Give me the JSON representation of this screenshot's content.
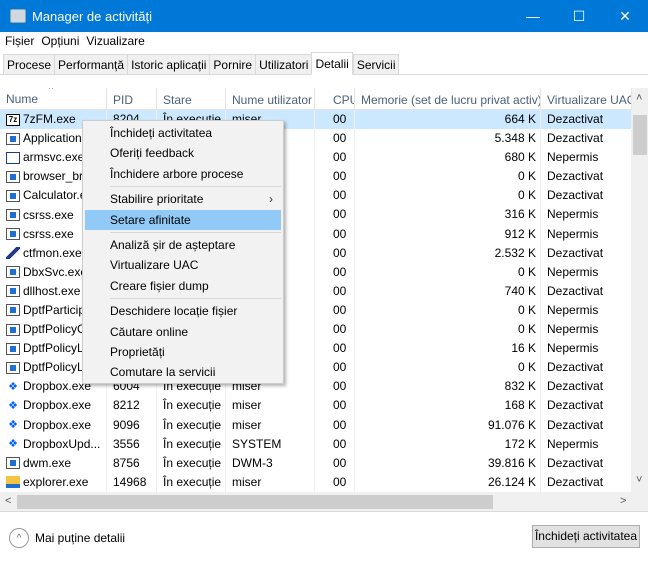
{
  "window": {
    "title": "Manager de activități",
    "minimize": "—",
    "maximize": "☐",
    "close": "✕"
  },
  "menu": [
    "Fișier",
    "Opțiuni",
    "Vizualizare"
  ],
  "tabs": [
    {
      "label": "Procese"
    },
    {
      "label": "Performanță"
    },
    {
      "label": "Istoric aplicații"
    },
    {
      "label": "Pornire"
    },
    {
      "label": "Utilizatori"
    },
    {
      "label": "Detalii",
      "active": true
    },
    {
      "label": "Servicii"
    }
  ],
  "columns": [
    "Nume",
    "PID",
    "Stare",
    "Nume utilizator",
    "CPU",
    "Memorie (set de lucru privat activ)",
    "Virtualizare UAC"
  ],
  "rows": [
    {
      "icon": "7zip-icon",
      "name": "7zFM.exe",
      "pid": "8204",
      "state": "În execuție",
      "user": "miser",
      "cpu": "00",
      "mem": "664 K",
      "uac": "Dezactivat",
      "selected": true
    },
    {
      "icon": "exe-icon",
      "name": "Application",
      "pid": "",
      "state": "",
      "user": "",
      "cpu": "00",
      "mem": "5.348 K",
      "uac": "Dezactivat"
    },
    {
      "icon": "window-icon",
      "name": "armsvc.exe",
      "pid": "",
      "state": "",
      "user": "",
      "cpu": "00",
      "mem": "680 K",
      "uac": "Nepermis"
    },
    {
      "icon": "exe-icon",
      "name": "browser_bro",
      "pid": "",
      "state": "",
      "user": "",
      "cpu": "00",
      "mem": "0 K",
      "uac": "Dezactivat"
    },
    {
      "icon": "exe-icon",
      "name": "Calculator.e",
      "pid": "",
      "state": "",
      "user": "",
      "cpu": "00",
      "mem": "0 K",
      "uac": "Dezactivat"
    },
    {
      "icon": "exe-icon",
      "name": "csrss.exe",
      "pid": "",
      "state": "",
      "user": "",
      "cpu": "00",
      "mem": "316 K",
      "uac": "Nepermis"
    },
    {
      "icon": "exe-icon",
      "name": "csrss.exe",
      "pid": "",
      "state": "",
      "user": "",
      "cpu": "00",
      "mem": "912 K",
      "uac": "Nepermis"
    },
    {
      "icon": "pen-icon",
      "name": "ctfmon.exe",
      "pid": "",
      "state": "",
      "user": "",
      "cpu": "00",
      "mem": "2.532 K",
      "uac": "Dezactivat"
    },
    {
      "icon": "exe-icon",
      "name": "DbxSvc.exe",
      "pid": "",
      "state": "",
      "user": "",
      "cpu": "00",
      "mem": "0 K",
      "uac": "Nepermis"
    },
    {
      "icon": "exe-icon",
      "name": "dllhost.exe",
      "pid": "",
      "state": "",
      "user": "",
      "cpu": "00",
      "mem": "740 K",
      "uac": "Dezactivat"
    },
    {
      "icon": "exe-icon",
      "name": "DptfParticip",
      "pid": "",
      "state": "",
      "user": "",
      "cpu": "00",
      "mem": "0 K",
      "uac": "Nepermis"
    },
    {
      "icon": "exe-icon",
      "name": "DptfPolicyC",
      "pid": "",
      "state": "",
      "user": "",
      "cpu": "00",
      "mem": "0 K",
      "uac": "Nepermis"
    },
    {
      "icon": "exe-icon",
      "name": "DptfPolicyL",
      "pid": "",
      "state": "",
      "user": "",
      "cpu": "00",
      "mem": "16 K",
      "uac": "Nepermis"
    },
    {
      "icon": "exe-icon",
      "name": "DptfPolicyL",
      "pid": "",
      "state": "",
      "user": "",
      "cpu": "00",
      "mem": "0 K",
      "uac": "Dezactivat"
    },
    {
      "icon": "dropbox-icon",
      "name": "Dropbox.exe",
      "pid": "6004",
      "state": "În execuție",
      "user": "miser",
      "cpu": "00",
      "mem": "832 K",
      "uac": "Dezactivat"
    },
    {
      "icon": "dropbox-icon",
      "name": "Dropbox.exe",
      "pid": "8212",
      "state": "În execuție",
      "user": "miser",
      "cpu": "00",
      "mem": "168 K",
      "uac": "Dezactivat"
    },
    {
      "icon": "dropbox-icon",
      "name": "Dropbox.exe",
      "pid": "9096",
      "state": "În execuție",
      "user": "miser",
      "cpu": "00",
      "mem": "91.076 K",
      "uac": "Dezactivat"
    },
    {
      "icon": "dropbox-icon",
      "name": "DropboxUpd...",
      "pid": "3556",
      "state": "În execuție",
      "user": "SYSTEM",
      "cpu": "00",
      "mem": "172 K",
      "uac": "Nepermis"
    },
    {
      "icon": "exe-icon",
      "name": "dwm.exe",
      "pid": "8756",
      "state": "În execuție",
      "user": "DWM-3",
      "cpu": "00",
      "mem": "39.816 K",
      "uac": "Dezactivat"
    },
    {
      "icon": "folder-icon",
      "name": "explorer.exe",
      "pid": "14968",
      "state": "În execuție",
      "user": "miser",
      "cpu": "00",
      "mem": "26.124 K",
      "uac": "Dezactivat"
    }
  ],
  "context_menu": {
    "groups": [
      [
        "Închideți activitatea",
        "Oferiți feedback",
        "Închidere arbore procese"
      ],
      [
        "Stabilire prioritate",
        "Setare afinitate"
      ],
      [
        "Analiză șir de așteptare",
        "Virtualizare UAC",
        "Creare fișier dump"
      ],
      [
        "Deschidere locație fișier",
        "Căutare online",
        "Proprietăți",
        "Comutare la servicii"
      ]
    ],
    "highlighted": "Setare afinitate",
    "submenu_item": "Stabilire prioritate"
  },
  "footer": {
    "fewer_details": "Mai puține detalii",
    "end_task": "Închideți activitatea"
  }
}
